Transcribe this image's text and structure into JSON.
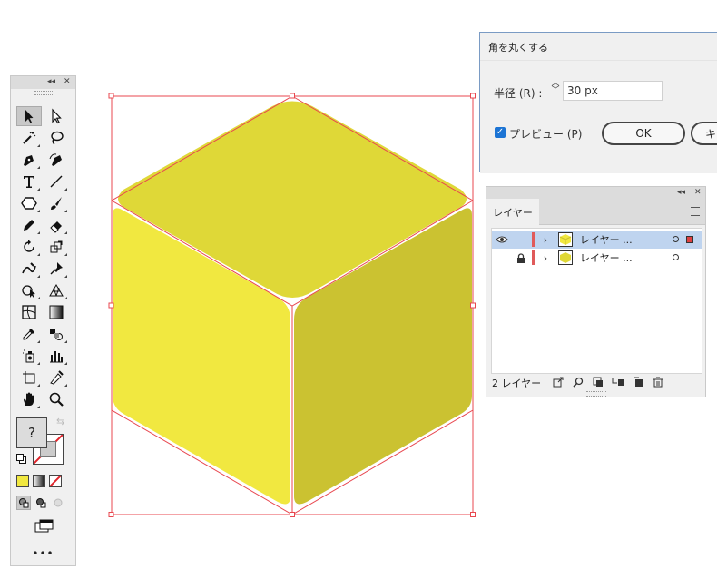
{
  "tools_panel": {
    "collapse_label": "◂◂",
    "close_label": "✕",
    "fill_label": "?",
    "more_label": "•••"
  },
  "colors": {
    "top_face": "#dfd837",
    "left_face": "#f1e840",
    "right_face": "#cbc231",
    "bbox_stroke": "#e8474f",
    "accent_blue": "#1c74d4",
    "selection_row": "#bfd4ef"
  },
  "dialog": {
    "title": "角を丸くする",
    "radius_label": "半径 (R) :",
    "radius_value": "30 px",
    "preview_label": "プレビュー (P)",
    "preview_checked": true,
    "ok_label": "OK",
    "cancel_label": "キ"
  },
  "layers_panel": {
    "tab_label": "レイヤー",
    "collapse_label": "◂◂",
    "close_label": "✕",
    "rows": [
      {
        "name": "レイヤー ...",
        "visible": true,
        "locked": false,
        "selected": true
      },
      {
        "name": "レイヤー ...",
        "visible": false,
        "locked": true,
        "selected": false
      }
    ],
    "footer_count": "2 レイヤー"
  }
}
